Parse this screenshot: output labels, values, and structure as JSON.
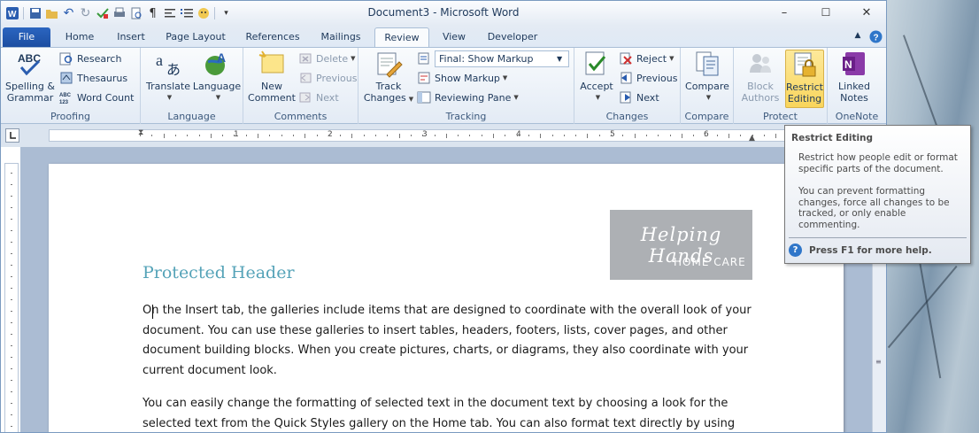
{
  "window": {
    "title": "Document3 - Microsoft Word",
    "controls": {
      "minimize": "–",
      "maximize": "☐",
      "close": "✕"
    }
  },
  "quick_access": {
    "icons": [
      "word-app-icon",
      "save-icon",
      "open-icon",
      "undo-icon",
      "redo-icon",
      "spelling-icon",
      "print-icon",
      "print-preview-icon",
      "paragraph-marks-icon",
      "align-icon",
      "numbering-icon",
      "customize-icon"
    ]
  },
  "tabs": {
    "items": [
      {
        "label": "File"
      },
      {
        "label": "Home"
      },
      {
        "label": "Insert"
      },
      {
        "label": "Page Layout"
      },
      {
        "label": "References"
      },
      {
        "label": "Mailings"
      },
      {
        "label": "Review"
      },
      {
        "label": "View"
      },
      {
        "label": "Developer"
      }
    ],
    "active": "Review"
  },
  "ribbon": {
    "proofing": {
      "label": "Proofing",
      "spelling": "Spelling &\nGrammar",
      "spelling_l1": "Spelling &",
      "spelling_l2": "Grammar",
      "research": "Research",
      "thesaurus": "Thesaurus",
      "word_count": "Word Count"
    },
    "language": {
      "label": "Language",
      "translate": "Translate",
      "language": "Language"
    },
    "comments": {
      "label": "Comments",
      "new_comment_l1": "New",
      "new_comment_l2": "Comment",
      "delete": "Delete",
      "previous": "Previous",
      "next": "Next"
    },
    "tracking": {
      "label": "Tracking",
      "track_changes_l1": "Track",
      "track_changes_l2": "Changes",
      "display_mode": "Final: Show Markup",
      "show_markup": "Show Markup",
      "reviewing_pane": "Reviewing Pane"
    },
    "changes": {
      "label": "Changes",
      "accept": "Accept",
      "reject": "Reject",
      "previous": "Previous",
      "next": "Next"
    },
    "compare": {
      "label": "Compare",
      "compare": "Compare"
    },
    "protect": {
      "label": "Protect",
      "block_authors_l1": "Block",
      "block_authors_l2": "Authors",
      "restrict_editing_l1": "Restrict",
      "restrict_editing_l2": "Editing"
    },
    "onenote": {
      "label": "OneNote",
      "linked_notes_l1": "Linked",
      "linked_notes_l2": "Notes"
    }
  },
  "ruler": {
    "numbers": [
      "1",
      "2",
      "3",
      "4",
      "5",
      "6"
    ]
  },
  "document": {
    "logo_line1": "Helping Hands",
    "logo_line2": "HOME CARE",
    "heading": "Protected Header",
    "paragraph1": "On the Insert tab, the galleries include items that are designed to coordinate with the overall look of your document. You can use these galleries to insert tables, headers, footers, lists, cover pages, and other document building blocks. When you create pictures, charts, or diagrams, they also coordinate with your current document look.",
    "paragraph2": "You can easily change the formatting of selected text in the document text by choosing a look for the selected text from the Quick Styles gallery on the Home tab. You can also format text directly by using"
  },
  "tooltip": {
    "title": "Restrict Editing",
    "body1": "Restrict how people edit or format specific parts of the document.",
    "body2": "You can prevent formatting changes, force all changes to be tracked, or only enable commenting.",
    "help": "Press F1 for more help."
  },
  "colors": {
    "heading": "#55a3b8",
    "file_tab": "#2b65c0",
    "highlight": "#f9d55c"
  }
}
